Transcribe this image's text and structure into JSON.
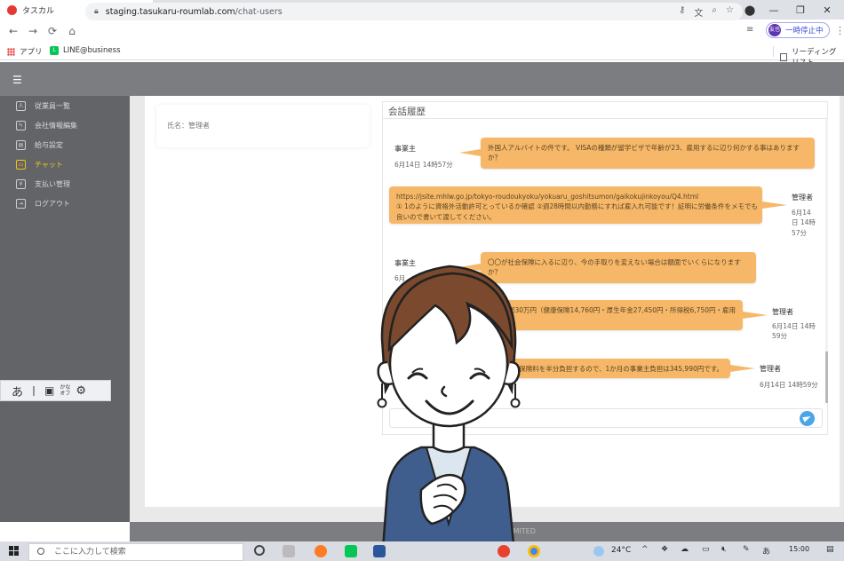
{
  "browser": {
    "tab_title": "タスカル",
    "url_host": "staging.tasukaru-roumlab.com",
    "url_path": "/chat-users",
    "pause_label": "一時停止中",
    "profile_avatar_text": "友也"
  },
  "bookmarks": {
    "apps": "アプリ",
    "line": "LINE@business",
    "reading_list": "リーディング リスト"
  },
  "sidebar": {
    "items": [
      {
        "label": "従業員一覧",
        "icon": "people-icon"
      },
      {
        "label": "会社情報編集",
        "icon": "edit-icon"
      },
      {
        "label": "給与設定",
        "icon": "chart-icon"
      },
      {
        "label": "チャット",
        "icon": "chat-icon"
      },
      {
        "label": "支払い管理",
        "icon": "payment-icon"
      },
      {
        "label": "ログアウト",
        "icon": "logout-icon"
      }
    ],
    "active_index": 3
  },
  "profile": {
    "name_line": "氏名：管理者"
  },
  "chat": {
    "title": "会話履歴",
    "messages": [
      {
        "side": "left",
        "sender": "事業主",
        "text": "外国人アルバイトの件です。 VISAの種類が留学ビザで年齢が23、雇用するに辺り何かする事はありますか？",
        "time": "6月14日 14時57分"
      },
      {
        "side": "right",
        "sender": "管理者",
        "text_line1": "https://jsite.mhlw.go.jp/tokyo-roudoukyoku/yokuaru_goshitsumon/gaikokujinkoyou/Q4.html",
        "text_line2": "① 1のように資格外活動許可とっているか確認 ②週28時間以内勤務にすれば雇入れ可能です！証明に労働条件をメモでも",
        "text_line3": "良いので書いて渡してください。",
        "time_line1": "6月14",
        "time_line2": "日 14時",
        "time_line3": "57分"
      },
      {
        "side": "left",
        "sender": "事業主",
        "text": "〇〇が社会保険に入るに辺り、今の手取りを変えない場合は額面でいくらになりますか？",
        "time": "6月"
      },
      {
        "side": "right",
        "sender": "管理者",
        "text": "額面30万円（健康保険14,760円・厚生年金27,450円・所得税6,750円・雇用",
        "time_line1": "6月14日 14時",
        "time_line2": "59分"
      },
      {
        "side": "right",
        "sender": "管理者",
        "text": "会社が保険料を半分負担するので、1か月の事業主負担は345,990円です。",
        "time": "6月14日 14時59分"
      }
    ],
    "input_placeholder": ""
  },
  "footer": {
    "copyright": "Copyright © Asour LIMITED"
  },
  "ime": {
    "mode": "あ",
    "kana_top": "かな",
    "kana_bottom": "オフ"
  },
  "taskbar": {
    "search_placeholder": "ここに入力して検索",
    "temperature": "24°C",
    "ime_indicator": "あ",
    "time": "15:00"
  },
  "colors": {
    "bubble": "#f6b868",
    "header": "#7c7d81",
    "sidebar": "#636468",
    "active_menu": "#f0c419",
    "send_button": "#4aa6e8"
  }
}
